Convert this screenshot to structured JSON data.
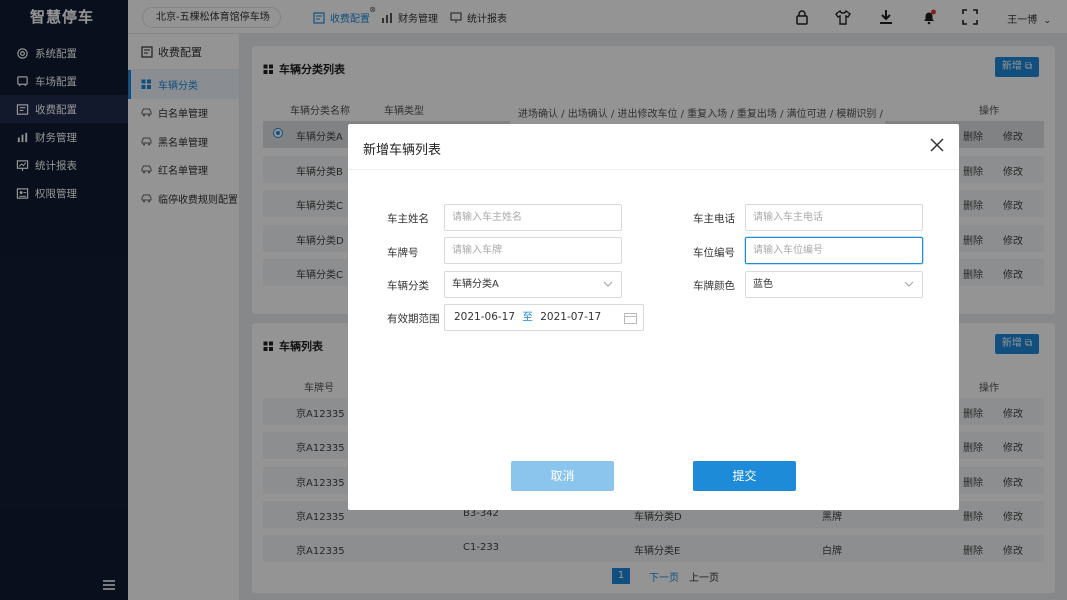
{
  "app": {
    "logo": "智慧停车"
  },
  "sidebar": {
    "items": [
      {
        "label": "系统配置",
        "icon": "settings-icon"
      },
      {
        "label": "车场配置",
        "icon": "parking-lot-icon"
      },
      {
        "label": "收费配置",
        "icon": "billing-icon",
        "active": true
      },
      {
        "label": "财务管理",
        "icon": "finance-icon"
      },
      {
        "label": "统计报表",
        "icon": "report-icon"
      },
      {
        "label": "权限管理",
        "icon": "permission-icon"
      }
    ]
  },
  "topbar": {
    "location": "北京-五棵松体育馆停车场",
    "tabs": [
      {
        "label": "收费配置",
        "active": true
      },
      {
        "label": "财务管理"
      },
      {
        "label": "统计报表"
      }
    ],
    "user": "王一博"
  },
  "subside": {
    "title": "收费配置",
    "items": [
      {
        "label": "车辆分类",
        "active": true
      },
      {
        "label": "白名单管理"
      },
      {
        "label": "黑名单管理"
      },
      {
        "label": "红名单管理"
      },
      {
        "label": "临停收费规则配置"
      }
    ]
  },
  "panel1": {
    "title": "车辆分类列表",
    "new_label": "新增",
    "columns": [
      "车辆分类名称",
      "车辆类型",
      "操作"
    ],
    "rows": [
      {
        "name": "车辆分类A",
        "selected": true
      },
      {
        "name": "车辆分类B"
      },
      {
        "name": "车辆分类C"
      },
      {
        "name": "车辆分类D"
      },
      {
        "name": "车辆分类C"
      }
    ],
    "action_delete": "删除",
    "action_edit": "修改",
    "type_hint": "进场确认 / 出场确认 / 进出修改车位 / 重复入场 / 重复出场 / 满位可进 / 模糊识别 /"
  },
  "panel2": {
    "title": "车辆列表",
    "new_label": "新增",
    "columns": [
      "车牌号",
      "操作"
    ],
    "rows": [
      {
        "plate": "京A12335",
        "slot": "",
        "category": "",
        "color": ""
      },
      {
        "plate": "京A12335",
        "slot": "",
        "category": "",
        "color": ""
      },
      {
        "plate": "京A12335",
        "slot": "",
        "category": "",
        "color": ""
      },
      {
        "plate": "京A12335",
        "slot": "B3-342",
        "category": "车辆分类D",
        "color": "黑牌"
      },
      {
        "plate": "京A12335",
        "slot": "C1-233",
        "category": "车辆分类E",
        "color": "白牌"
      }
    ],
    "pager": {
      "current": "1",
      "next": "下一页",
      "prev": "上一页"
    }
  },
  "modal": {
    "title": "新增车辆列表",
    "owner_name": {
      "label": "车主姓名",
      "placeholder": "请输入车主姓名"
    },
    "owner_phone": {
      "label": "车主电话",
      "placeholder": "请输入车主电话"
    },
    "plate": {
      "label": "车牌号",
      "placeholder": "请输入车牌"
    },
    "slot": {
      "label": "车位编号",
      "placeholder": "请输入车位编号"
    },
    "category": {
      "label": "车辆分类",
      "value": "车辆分类A"
    },
    "plate_color": {
      "label": "车牌颜色",
      "value": "蓝色"
    },
    "validity": {
      "label": "有效期范围",
      "start": "2021-06-17",
      "to": "至",
      "end": "2021-07-17"
    },
    "cancel": "取消",
    "submit": "提交"
  },
  "colors": {
    "accent": "#1e8bd9",
    "sidebar": "#111b33",
    "cancel": "#8bc5ee"
  }
}
